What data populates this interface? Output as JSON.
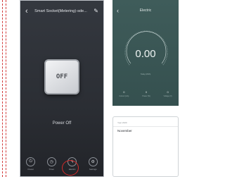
{
  "left_screen": {
    "title": "Smart Socket(Metering)-sde...",
    "back_icon": "back-chevron-icon",
    "edit_icon": "pencil-icon",
    "power_button_label": "OFF",
    "power_status": "Power Off",
    "tabs": [
      {
        "icon": "power-icon",
        "label": "Power"
      },
      {
        "icon": "timer-icon",
        "label": "Timer"
      },
      {
        "icon": "energy-icon",
        "label": "Electric"
      },
      {
        "icon": "settings-icon",
        "label": "Settings"
      }
    ],
    "highlight_color": "#d32a2a"
  },
  "right_screen": {
    "title": "Electric",
    "back_icon": "back-chevron-icon",
    "reading": "0.00",
    "reading_subtitle": "Today (kWh)",
    "stats": [
      {
        "value": "0",
        "label": "Current (mA)"
      },
      {
        "value": "0",
        "label": "Power (W)"
      },
      {
        "value": "0",
        "label": "Voltage (V)"
      }
    ],
    "history_year": "Year 2020",
    "history_month": "November"
  }
}
